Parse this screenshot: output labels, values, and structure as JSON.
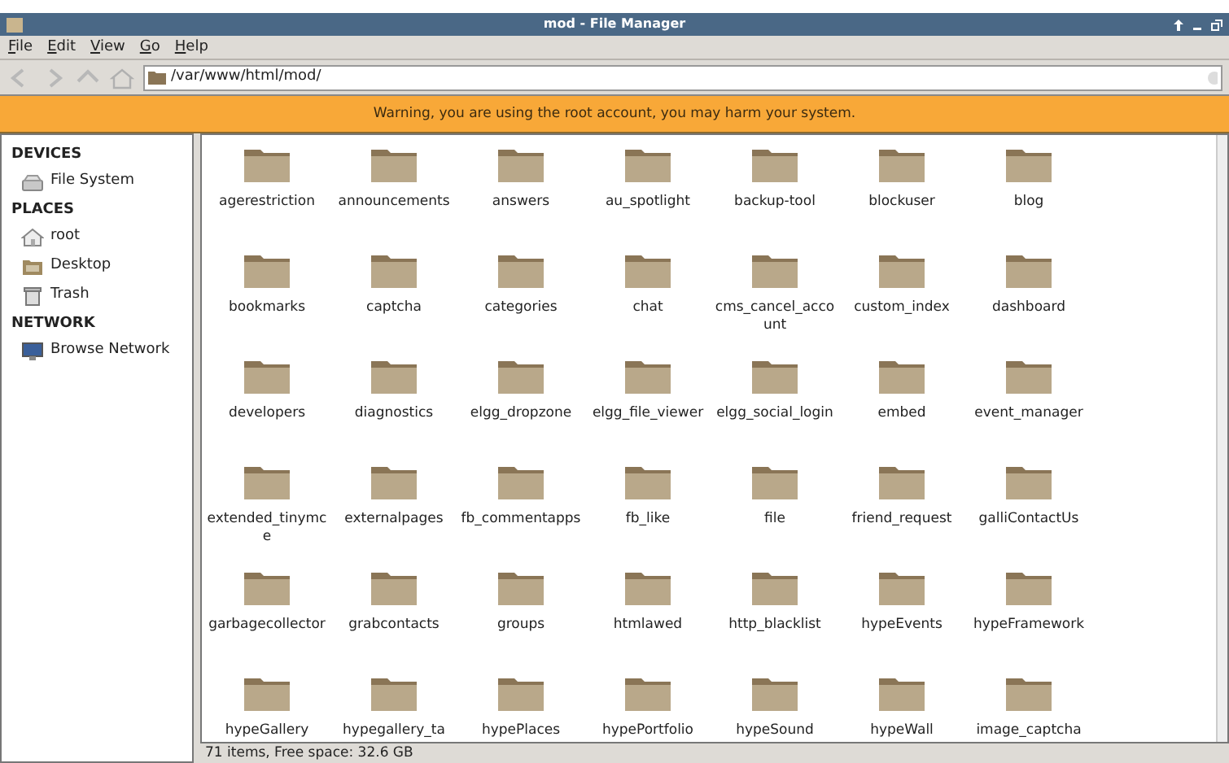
{
  "window": {
    "title": "mod - File Manager"
  },
  "menu": [
    "File",
    "Edit",
    "View",
    "Go",
    "Help"
  ],
  "location": {
    "value": "/var/www/html/mod/"
  },
  "warning": "Warning, you are using the root account, you may harm your system.",
  "sidebar": [
    {
      "title": "DEVICES",
      "items": [
        {
          "label": "File System",
          "kind": "drive"
        }
      ]
    },
    {
      "title": "PLACES",
      "items": [
        {
          "label": "root",
          "kind": "home"
        },
        {
          "label": "Desktop",
          "kind": "desktop"
        },
        {
          "label": "Trash",
          "kind": "trash"
        }
      ]
    },
    {
      "title": "NETWORK",
      "items": [
        {
          "label": "Browse Network",
          "kind": "network"
        }
      ]
    }
  ],
  "files": [
    "agerestriction",
    "announcements",
    "answers",
    "au_spotlight",
    "backup-tool",
    "blockuser",
    "blog",
    "bookmarks",
    "captcha",
    "categories",
    "chat",
    "cms_cancel_account",
    "custom_index",
    "dashboard",
    "developers",
    "diagnostics",
    "elgg_dropzone",
    "elgg_file_viewer",
    "elgg_social_login",
    "embed",
    "event_manager",
    "extended_tinymce",
    "externalpages",
    "fb_commentapps",
    "fb_like",
    "file",
    "friend_request",
    "galliContactUs",
    "garbagecollector",
    "grabcontacts",
    "groups",
    "htmlawed",
    "http_blacklist",
    "hypeEvents",
    "hypeFramework",
    "hypeGallery",
    "hypegallery_ta",
    "hypePlaces",
    "hypePortfolio",
    "hypeSound",
    "hypeWall",
    "image_captcha"
  ],
  "status_bar": "71 items, Free space: 32.6 GB"
}
